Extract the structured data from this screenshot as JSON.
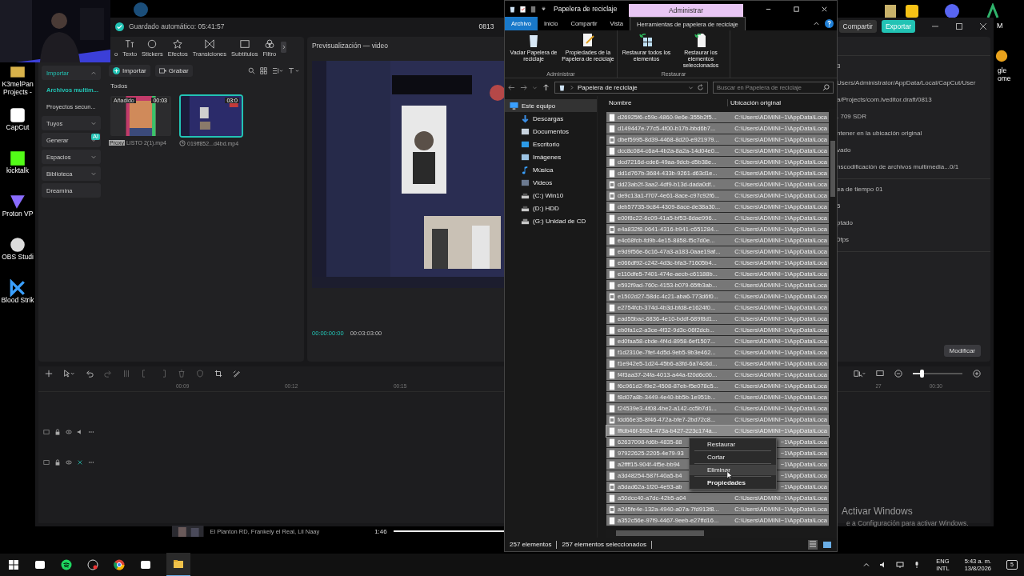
{
  "desktop": {
    "icons": [
      {
        "label": "K3melPan Projects -",
        "kind": "folder"
      },
      {
        "label": "CapCut",
        "kind": "capcut"
      },
      {
        "label": "kicktalk",
        "kind": "kick"
      },
      {
        "label": "Proton VP",
        "kind": "proton"
      },
      {
        "label": "OBS Studi",
        "kind": "obs"
      },
      {
        "label": "Blood Strik",
        "kind": "blood"
      }
    ],
    "right_label": "gle ome",
    "corner_label": "M"
  },
  "capcut": {
    "autosave": "Guardado automático: 05:41:57",
    "project": "0813",
    "share": "Compartir",
    "export": "Exportar",
    "tools": [
      {
        "label": "o",
        "kind": "media"
      },
      {
        "label": "Texto",
        "kind": "text"
      },
      {
        "label": "Stickers",
        "kind": "sticker"
      },
      {
        "label": "Efectos",
        "kind": "effect"
      },
      {
        "label": "Transiciones",
        "kind": "transition"
      },
      {
        "label": "Subtítulos",
        "kind": "caption"
      },
      {
        "label": "Filtro",
        "kind": "filter"
      }
    ],
    "nav": [
      {
        "label": "Importar",
        "kind": "group",
        "selected": true,
        "expanded": true
      },
      {
        "label": "Archivos multim...",
        "kind": "sub",
        "selected": true
      },
      {
        "label": "Proyectos secun...",
        "kind": "sub",
        "selected": false
      },
      {
        "label": "Tuyos",
        "kind": "group",
        "selected": false,
        "expanded": false
      },
      {
        "label": "Generar",
        "kind": "group",
        "selected": false,
        "expanded": false,
        "badge": "AI"
      },
      {
        "label": "Espacios",
        "kind": "group",
        "selected": false,
        "expanded": false
      },
      {
        "label": "Biblioteca",
        "kind": "group",
        "selected": false,
        "expanded": false
      },
      {
        "label": "Dreamina",
        "kind": "plain",
        "selected": false
      }
    ],
    "import_button": "Importar",
    "record_button": "Grabar",
    "filter": "Todos",
    "media": [
      {
        "name": "LISTO 2(1).mp4",
        "duration": "00:03",
        "status": "Añadido",
        "tag": "Proxy",
        "selected": false
      },
      {
        "name": "019ff852...d4bd.mp4",
        "duration": "03:0",
        "selected": true
      }
    ],
    "preview": {
      "title": "Previsualización — video",
      "current": "00:00:00:00",
      "total": "00:03:03:00"
    },
    "details": [
      [
        "3",
        "Users/Administrator/AppData/Local/CapCut/User",
        "a/Projects/com.lveditor.draft/0813",
        ". 709 SDR",
        "ntener en la ubicación original",
        "vado",
        "nscodificación de archivos multimedia...0/1"
      ],
      [
        "ea de tiempo 01",
        "5",
        "ptado",
        "0fps"
      ]
    ],
    "modify_button": "Modificar",
    "timeline": {
      "ticks": [
        "00:09",
        "00:12",
        "00:15"
      ],
      "right_ticks": [
        "27",
        "00:30"
      ],
      "zoom": {
        "level": 0.18
      },
      "tracks": [
        {
          "kind": "video"
        },
        {
          "kind": "audio"
        }
      ]
    }
  },
  "explorer": {
    "title": "Papelera de reciclaje",
    "context_tab": "Administrar",
    "tabs": [
      {
        "label": "Archivo",
        "kind": "file",
        "selected": false
      },
      {
        "label": "Inicio",
        "kind": "tab",
        "selected": false
      },
      {
        "label": "Compartir",
        "kind": "tab",
        "selected": false
      },
      {
        "label": "Vista",
        "kind": "tab",
        "selected": false
      },
      {
        "label": "Herramientas de papelera de reciclaje",
        "kind": "tab",
        "selected": true
      }
    ],
    "ribbon": [
      {
        "label": "Administrar",
        "buttons": [
          {
            "label": "Vaciar Papelera de reciclaje",
            "kind": "bin"
          },
          {
            "label": "Propiedades de la Papelera de reciclaje",
            "kind": "props"
          }
        ]
      },
      {
        "label": "Restaurar",
        "buttons": [
          {
            "label": "Restaurar todos los elementos",
            "kind": "restore_all"
          },
          {
            "label": "Restaurar los elementos seleccionados",
            "kind": "restore_sel"
          }
        ]
      }
    ],
    "address": "Papelera de reciclaje",
    "search": {
      "placeholder": "Buscar en Papelera de reciclaje"
    },
    "nav": [
      {
        "label": "Este equipo",
        "kind": "pc",
        "selected": true,
        "children": [
          {
            "label": "Descargas",
            "kind": "downloads",
            "selected": false
          },
          {
            "label": "Documentos",
            "kind": "documents",
            "selected": false
          },
          {
            "label": "Escritorio",
            "kind": "desktop",
            "selected": false
          },
          {
            "label": "Imágenes",
            "kind": "pictures",
            "selected": false
          },
          {
            "label": "Música",
            "kind": "music",
            "selected": false
          },
          {
            "label": "Videos",
            "kind": "videos",
            "selected": false
          },
          {
            "label": "(C:) Win10",
            "kind": "drive",
            "selected": false
          },
          {
            "label": "(D:) HDD",
            "kind": "drive",
            "selected": false
          },
          {
            "label": "(G:) Unidad de CD",
            "kind": "cd",
            "selected": false
          }
        ]
      }
    ],
    "columns": [
      "Nombre",
      "Ubicación original"
    ],
    "rows": [
      {
        "name": "d26925f6-c59c-4860-9e6e-355b2f5...",
        "location": "C:\\Users\\ADMINI~1\\AppData\\Loca",
        "kind": "file",
        "selected": true,
        "focused": false
      },
      {
        "name": "d149447e-77c5-4f00-b17b-bbd6b7...",
        "location": "C:\\Users\\ADMINI~1\\AppData\\Loca",
        "kind": "file",
        "selected": true,
        "focused": false
      },
      {
        "name": "dbef5995-8d39-4468-8d20-e921979...",
        "location": "C:\\Users\\ADMINI~1\\AppData\\Loca",
        "kind": "media",
        "selected": true,
        "focused": false
      },
      {
        "name": "dcc8c084-c6a4-4b2a-8a2a-14d04e0...",
        "location": "C:\\Users\\ADMINI~1\\AppData\\Loca",
        "kind": "file",
        "selected": true,
        "focused": false
      },
      {
        "name": "dcd7216d-cde6-49aa-9dcb-d5b38e...",
        "location": "C:\\Users\\ADMINI~1\\AppData\\Loca",
        "kind": "file",
        "selected": true,
        "focused": false
      },
      {
        "name": "dd1d767b-3684-433b-9261-d63d1e...",
        "location": "C:\\Users\\ADMINI~1\\AppData\\Loca",
        "kind": "file",
        "selected": true,
        "focused": false
      },
      {
        "name": "dd23ab2f-3aa2-4df9-b13d-dada0df...",
        "location": "C:\\Users\\ADMINI~1\\AppData\\Loca",
        "kind": "media",
        "selected": true,
        "focused": false
      },
      {
        "name": "de9c13a1-f707-4e61-8ace-c97c92f6...",
        "location": "C:\\Users\\ADMINI~1\\AppData\\Loca",
        "kind": "media",
        "selected": true,
        "focused": false
      },
      {
        "name": "deb57735-9c84-4309-8ace-de38a30...",
        "location": "C:\\Users\\ADMINI~1\\AppData\\Loca",
        "kind": "file",
        "selected": true,
        "focused": false
      },
      {
        "name": "e00f8c22-6c09-41a5-bf53-8dae996...",
        "location": "C:\\Users\\ADMINI~1\\AppData\\Loca",
        "kind": "file",
        "selected": true,
        "focused": false
      },
      {
        "name": "e4a832f8-0641-4316-b941-c651284...",
        "location": "C:\\Users\\ADMINI~1\\AppData\\Loca",
        "kind": "media",
        "selected": true,
        "focused": false
      },
      {
        "name": "e4c68fcb-fd9b-4e15-8858-f5c7d0e...",
        "location": "C:\\Users\\ADMINI~1\\AppData\\Loca",
        "kind": "file",
        "selected": true,
        "focused": false
      },
      {
        "name": "e9d9f56e-6c16-47a3-a183-0aae19af...",
        "location": "C:\\Users\\ADMINI~1\\AppData\\Loca",
        "kind": "file",
        "selected": true,
        "focused": false
      },
      {
        "name": "e066df92-c242-4d3c-bfa3-71605b4...",
        "location": "C:\\Users\\ADMINI~1\\AppData\\Loca",
        "kind": "file",
        "selected": true,
        "focused": false
      },
      {
        "name": "e110dfe5-7401-474e-aecb-c61188b...",
        "location": "C:\\Users\\ADMINI~1\\AppData\\Loca",
        "kind": "file",
        "selected": true,
        "focused": false
      },
      {
        "name": "e592f9ad-760c-4153-b079-65fb3ab...",
        "location": "C:\\Users\\ADMINI~1\\AppData\\Loca",
        "kind": "file",
        "selected": true,
        "focused": false
      },
      {
        "name": "e1502d27-58dc-4c21-aba6-773d6f0...",
        "location": "C:\\Users\\ADMINI~1\\AppData\\Loca",
        "kind": "media",
        "selected": true,
        "focused": false
      },
      {
        "name": "e2754fcb-374d-4b3d-bfd8-e1624f0...",
        "location": "C:\\Users\\ADMINI~1\\AppData\\Loca",
        "kind": "file",
        "selected": true,
        "focused": false
      },
      {
        "name": "ead55bac-6836-4e10-bddf-689f8d1...",
        "location": "C:\\Users\\ADMINI~1\\AppData\\Loca",
        "kind": "file",
        "selected": true,
        "focused": false
      },
      {
        "name": "eb0fa1c2-a3ce-4f32-9d3c-06f2dcb...",
        "location": "C:\\Users\\ADMINI~1\\AppData\\Loca",
        "kind": "file",
        "selected": true,
        "focused": false
      },
      {
        "name": "ed0faa58-cbde-4f4d-8958-6ef1507...",
        "location": "C:\\Users\\ADMINI~1\\AppData\\Loca",
        "kind": "file",
        "selected": true,
        "focused": false
      },
      {
        "name": "f1d2310e-7fef-4d5d-9eb5-9b3e462...",
        "location": "C:\\Users\\ADMINI~1\\AppData\\Loca",
        "kind": "file",
        "selected": true,
        "focused": false
      },
      {
        "name": "f1e942e5-1d24-45b6-a3fd-6a74c6d...",
        "location": "C:\\Users\\ADMINI~1\\AppData\\Loca",
        "kind": "file",
        "selected": true,
        "focused": false
      },
      {
        "name": "f4f3aa37-24fa-4013-a44a-f20d6c00...",
        "location": "C:\\Users\\ADMINI~1\\AppData\\Loca",
        "kind": "file",
        "selected": true,
        "focused": false
      },
      {
        "name": "f6c961d2-f9e2-4508-87eb-f5e078c5...",
        "location": "C:\\Users\\ADMINI~1\\AppData\\Loca",
        "kind": "file",
        "selected": true,
        "focused": false
      },
      {
        "name": "f8d07a8b-3449-4e40-bb5b-1e951b...",
        "location": "C:\\Users\\ADMINI~1\\AppData\\Loca",
        "kind": "file",
        "selected": true,
        "focused": false
      },
      {
        "name": "f24539e3-4f08-4be2-a142-cc5b7d1...",
        "location": "C:\\Users\\ADMINI~1\\AppData\\Loca",
        "kind": "file",
        "selected": true,
        "focused": false
      },
      {
        "name": "fdd66e35-8f46-472a-bfe7-2bd72c8...",
        "location": "C:\\Users\\ADMINI~1\\AppData\\Loca",
        "kind": "media",
        "selected": true,
        "focused": false
      },
      {
        "name": "fffdb46f-5924-473a-b427-223c174a...",
        "location": "C:\\Users\\ADMINI~1\\AppData\\Loca",
        "kind": "file",
        "selected": true,
        "focused": true
      },
      {
        "name": "62637098-fd6b-4835-88",
        "location": "~1\\AppData\\Loca",
        "kind": "file",
        "selected": true,
        "focused": false
      },
      {
        "name": "97922625-2205-4e79-93",
        "location": "~1\\AppData\\Loca",
        "kind": "file",
        "selected": true,
        "focused": false
      },
      {
        "name": "a2ffff15-904f-4f5e-bb94",
        "location": "~1\\AppData\\Loca",
        "kind": "file",
        "selected": true,
        "focused": false
      },
      {
        "name": "a3d48254-587f-40a5-b4",
        "location": "~1\\AppData\\Loca",
        "kind": "file",
        "selected": true,
        "focused": false
      },
      {
        "name": "a5dad62a-1f20-4e93-ab",
        "location": "~1\\AppData\\Loca",
        "kind": "media",
        "selected": true,
        "focused": false
      },
      {
        "name": "a50dcc40-a7dc-42b5-a04",
        "location": "C:\\Users\\ADMINI~1\\AppData\\Loca",
        "kind": "file",
        "selected": true,
        "focused": false
      },
      {
        "name": "a245fe4e-132a-4940-a07a-7fd913f8...",
        "location": "C:\\Users\\ADMINI~1\\AppData\\Loca",
        "kind": "media",
        "selected": true,
        "focused": false
      },
      {
        "name": "a352c56e-97f9-4467-9eeb-e27ffd16...",
        "location": "C:\\Users\\ADMINI~1\\AppData\\Loca",
        "kind": "file",
        "selected": true,
        "focused": false
      }
    ],
    "menu": [
      {
        "label": "Restaurar",
        "hovered": false,
        "default": false
      },
      {
        "label": "Cortar",
        "hovered": false,
        "default": false
      },
      {
        "label": "Eliminar",
        "hovered": true,
        "default": false
      },
      {
        "label": "Propiedades",
        "hovered": false,
        "default": true
      }
    ],
    "status": [
      "257 elementos",
      "257 elementos seleccionados"
    ]
  },
  "music": {
    "artist": "El Planton RD, Frankely el Real, Lil Naay",
    "time": "1:46",
    "level": 1
  },
  "activation": {
    "title": "Activar Windows",
    "text": "e a Configuración para activar Windows."
  },
  "taskbar": {
    "language": "ENG",
    "layout": "INTL",
    "time": "5:43 a. m.",
    "date": "13/8/2026",
    "notifications": "5"
  }
}
